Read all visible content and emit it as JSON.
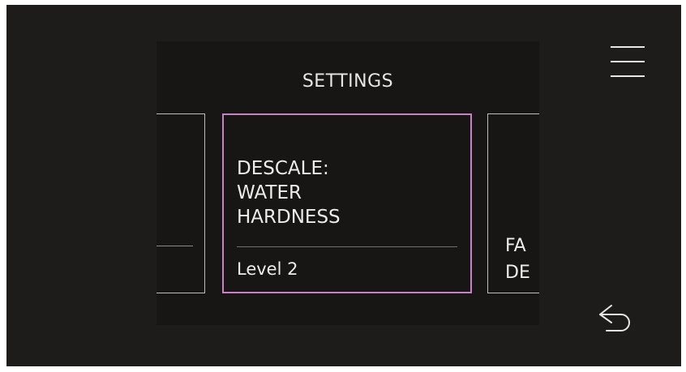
{
  "header": {
    "title": "SETTINGS"
  },
  "cards": {
    "center": {
      "name": "DESCALE:\nWATER\nHARDNESS",
      "value": "Level 2"
    },
    "right": {
      "partial_text": "FA\nDE"
    }
  },
  "icons": {
    "menu": "hamburger-menu-icon",
    "back": "back-arrow-icon"
  },
  "colors": {
    "background": "#1e1b1b",
    "panel": "#181515",
    "accent": "#c781c4",
    "text": "#ececec"
  }
}
